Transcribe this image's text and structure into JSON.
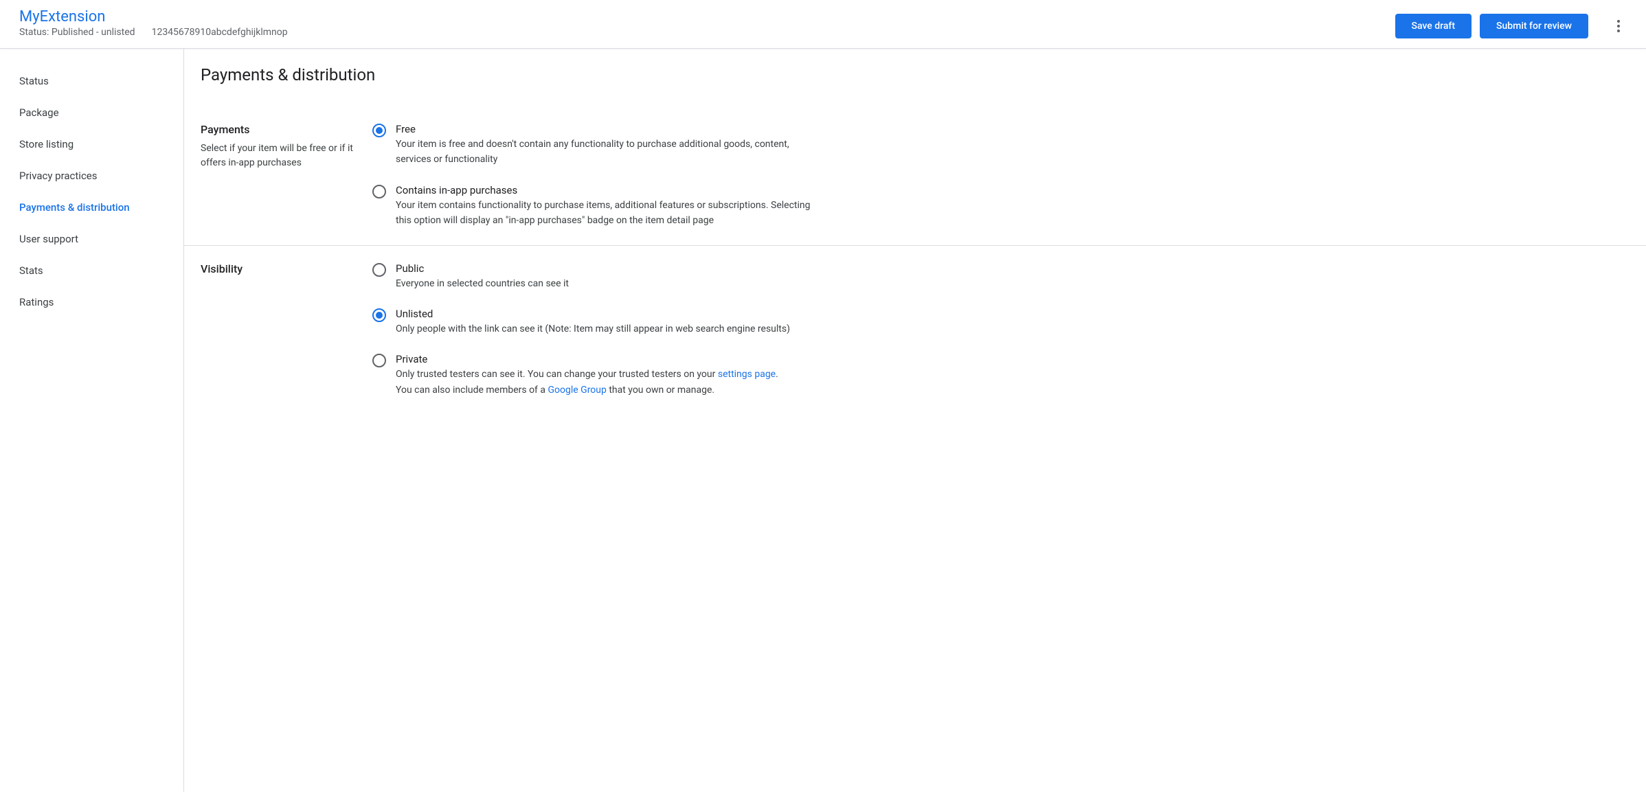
{
  "header": {
    "title": "MyExtension",
    "status_label": "Status: Published - unlisted",
    "item_id": "12345678910abcdefghijklmnop",
    "save_draft_label": "Save draft",
    "submit_label": "Submit for review"
  },
  "sidebar": {
    "items": [
      {
        "label": "Status",
        "active": false
      },
      {
        "label": "Package",
        "active": false
      },
      {
        "label": "Store listing",
        "active": false
      },
      {
        "label": "Privacy practices",
        "active": false
      },
      {
        "label": "Payments & distribution",
        "active": true
      },
      {
        "label": "User support",
        "active": false
      },
      {
        "label": "Stats",
        "active": false
      },
      {
        "label": "Ratings",
        "active": false
      }
    ]
  },
  "page": {
    "title": "Payments & distribution"
  },
  "payments": {
    "title": "Payments",
    "description": "Select if your item will be free or if it offers in-app purchases",
    "options": [
      {
        "label": "Free",
        "description": "Your item is free and doesn't contain any functionality to purchase additional goods, content, services or functionality",
        "selected": true
      },
      {
        "label": "Contains in-app purchases",
        "description": "Your item contains functionality to purchase items, additional features or subscriptions. Selecting this option will display an \"in-app purchases\" badge on the item detail page",
        "selected": false
      }
    ]
  },
  "visibility": {
    "title": "Visibility",
    "options": [
      {
        "label": "Public",
        "description": "Everyone in selected countries can see it",
        "selected": false
      },
      {
        "label": "Unlisted",
        "description": "Only people with the link can see it (Note: Item may still appear in web search engine results)",
        "selected": true
      },
      {
        "label": "Private",
        "desc_part1": "Only trusted testers can see it. You can change your trusted testers on your ",
        "link1": "settings page",
        "desc_part2": ".",
        "desc_part3": "You can also include members of a ",
        "link2": "Google Group",
        "desc_part4": " that you own or manage.",
        "selected": false
      }
    ]
  }
}
